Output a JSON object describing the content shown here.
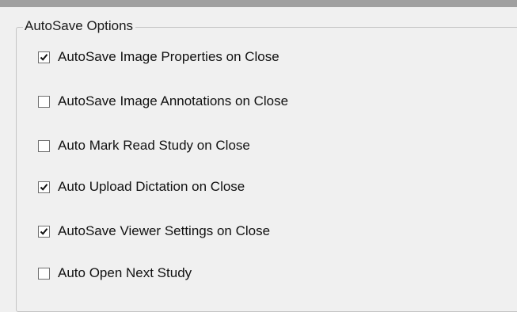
{
  "group": {
    "title": "AutoSave Options"
  },
  "options": [
    {
      "label": "AutoSave Image Properties on Close",
      "checked": true
    },
    {
      "label": "AutoSave Image Annotations on Close",
      "checked": false
    },
    {
      "label": "Auto Mark Read Study on Close",
      "checked": false
    },
    {
      "label": "Auto Upload Dictation on Close",
      "checked": true
    },
    {
      "label": "AutoSave Viewer Settings on Close",
      "checked": true
    },
    {
      "label": "Auto Open Next Study",
      "checked": false
    }
  ]
}
